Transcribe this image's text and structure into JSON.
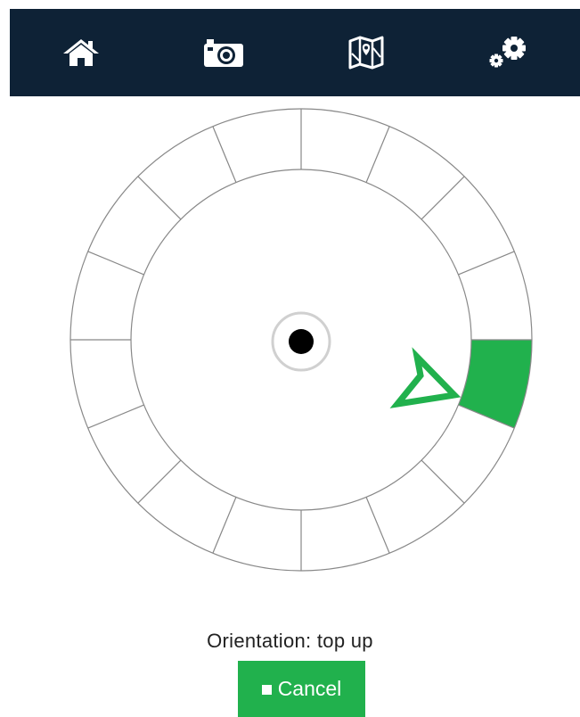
{
  "navbar": {
    "items": [
      {
        "name": "home",
        "icon": "home-icon"
      },
      {
        "name": "camera",
        "icon": "camera-icon"
      },
      {
        "name": "map",
        "icon": "map-icon"
      },
      {
        "name": "settings",
        "icon": "gears-icon"
      }
    ],
    "background_color": "#0e2236",
    "icon_color": "#ffffff"
  },
  "dial": {
    "segment_count": 16,
    "active_segment_index": 0,
    "active_color": "#21b14d",
    "line_color": "#888888",
    "center_dot_icon": "target-dot-icon",
    "pointer_icon": "pointer-arrow-icon"
  },
  "status": {
    "orientation_text": "Orientation: top up"
  },
  "cancel": {
    "icon": "stop-icon",
    "label": "Cancel",
    "color": "#21b14d"
  }
}
